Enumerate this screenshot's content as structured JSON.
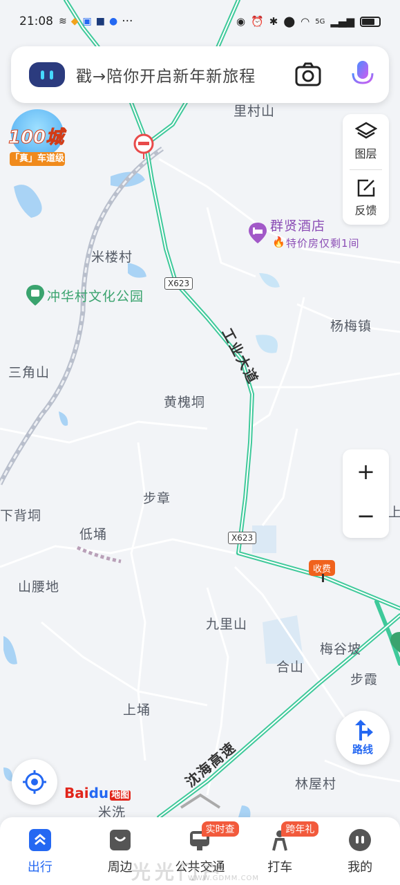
{
  "status_bar": {
    "time": "21:08",
    "more": "···",
    "network": "5G",
    "battery_level": 0.75
  },
  "search": {
    "placeholder": "戳→陪你开启新年新旅程",
    "camera_icon": "camera-icon",
    "mic_icon": "microphone-icon"
  },
  "badge": {
    "number": "100城",
    "ribbon": "「真」车道级"
  },
  "controls": {
    "layers_label": "图层",
    "feedback_label": "反馈",
    "zoom_in": "+",
    "zoom_out": "−",
    "route_label": "路线"
  },
  "map": {
    "places": [
      {
        "name": "里村山"
      },
      {
        "name": "米楼村"
      },
      {
        "name": "冲华村文化公园"
      },
      {
        "name": "三角山"
      },
      {
        "name": "杨梅镇"
      },
      {
        "name": "黄槐垌"
      },
      {
        "name": "步章"
      },
      {
        "name": "下背垌"
      },
      {
        "name": "低埇"
      },
      {
        "name": "山腰地"
      },
      {
        "name": "九里山"
      },
      {
        "name": "梅谷坡"
      },
      {
        "name": "合山"
      },
      {
        "name": "步霞"
      },
      {
        "name": "上埇"
      },
      {
        "name": "林屋村"
      },
      {
        "name": "米洗"
      },
      {
        "name": "上"
      }
    ],
    "poi_hotel": "群贤酒店",
    "poi_promo": "特价房仅剩1间",
    "road_tag_1": "X623",
    "road_tag_2": "X623",
    "road_name_1": "工业大道",
    "road_name_2": "沈海高速",
    "toll_label": "收费",
    "logo_text": "Bai",
    "logo_du": "du",
    "logo_ditu": "地图"
  },
  "bottom_nav": {
    "items": [
      {
        "label": "出行",
        "active": true
      },
      {
        "label": "周边"
      },
      {
        "label": "公共交通",
        "badge": "实时查"
      },
      {
        "label": "打车",
        "badge": "跨年礼"
      },
      {
        "label": "我的"
      }
    ]
  },
  "watermark": "光光门户",
  "watermark_url": "WWW.GDMM.COM",
  "colors": {
    "accent": "#2468f2",
    "road_green": "#3ec99a",
    "poi_purple": "#8b4db5",
    "badge_red": "#f25a3c"
  }
}
